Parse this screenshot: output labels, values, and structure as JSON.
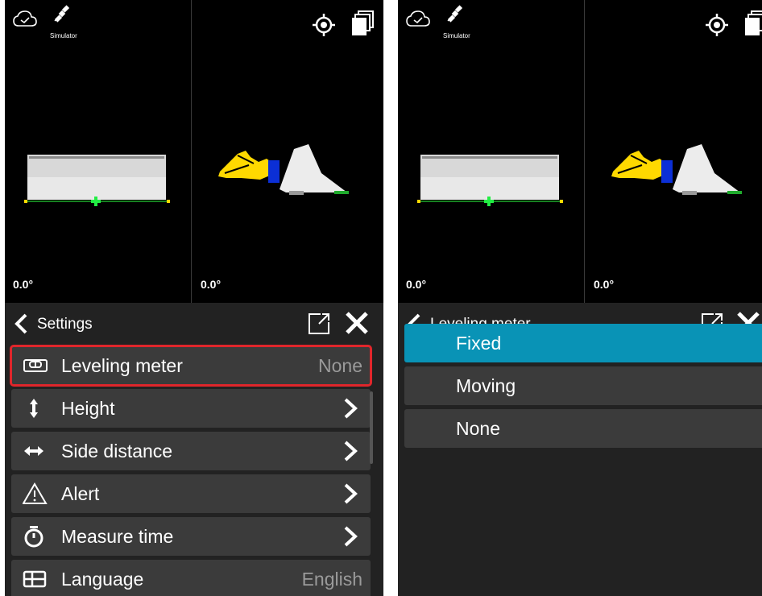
{
  "left_screen": {
    "status": {
      "simulator_label": "Simulator"
    },
    "views": {
      "front_angle": "0.0°",
      "side_angle": "0.0°"
    },
    "header": {
      "title": "Settings"
    },
    "menu": [
      {
        "label": "Leveling meter",
        "value": "None",
        "icon": "leveling-meter-icon",
        "highlighted": true
      },
      {
        "label": "Height",
        "value": "",
        "icon": "height-arrows-icon"
      },
      {
        "label": "Side distance",
        "value": "",
        "icon": "side-distance-arrows-icon"
      },
      {
        "label": "Alert",
        "value": "",
        "icon": "alert-triangle-icon"
      },
      {
        "label": "Measure time",
        "value": "",
        "icon": "stopwatch-icon"
      },
      {
        "label": "Language",
        "value": "English",
        "icon": "language-grid-icon"
      }
    ]
  },
  "right_screen": {
    "status": {
      "simulator_label": "Simulator"
    },
    "views": {
      "front_angle": "0.0°",
      "side_angle": "0.0°"
    },
    "header": {
      "title": "Leveling meter"
    },
    "options": [
      {
        "label": "Fixed",
        "selected": true
      },
      {
        "label": "Moving",
        "selected": false
      },
      {
        "label": "None",
        "selected": false
      }
    ]
  },
  "colors": {
    "selected_option": "#0993b6",
    "highlight_outline": "#e0262b",
    "row_background": "#3b3b3b",
    "panel_background": "#222222",
    "machine_yellow": "#ffd900",
    "machine_blue": "#0b2fd6",
    "ground_green": "#1faa2c"
  }
}
